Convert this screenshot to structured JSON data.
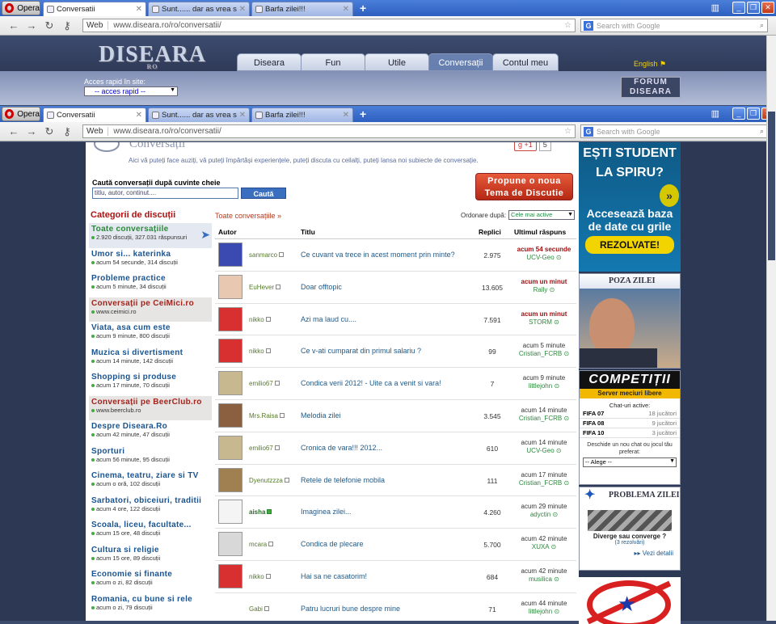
{
  "browser": {
    "opera_label": "Opera",
    "tabs": [
      {
        "label": "Conversatii",
        "active": true
      },
      {
        "label": "Sunt...... dar as vrea sa...",
        "active": false
      },
      {
        "label": "Barfa zilei!!!",
        "active": false
      }
    ],
    "web_label": "Web",
    "url": "www.diseara.ro/ro/conversatii/",
    "search_placeholder": "Search with Google"
  },
  "site": {
    "logo": "DISEARA",
    "logo_sub": "RO",
    "nav": [
      "Diseara",
      "Fun",
      "Utile",
      "Conversații",
      "Contul meu"
    ],
    "nav_active": "Conversații",
    "language": "English",
    "quick_label": "Acces rapid în site:",
    "quick_select": "-- acces rapid --",
    "forum_badge": "FORUM DISEARA"
  },
  "page": {
    "title": "Conversații",
    "intro": "Aici vă puteți face auziți, vă puteți împărtăși experiențele, puteți discuta cu ceilalți, puteți lansa noi subiecte de conversație.",
    "gplus_label": "+1",
    "gplus_count": "5",
    "search_label": "Caută conversații după cuvinte cheie",
    "search_placeholder": "titlu, autor, continut....",
    "search_button": "Caută",
    "propose_line1": "Propune o noua",
    "propose_line2": "Tema de Discutie",
    "categories_header": "Categorii de discuții",
    "all_label": "Toate conversațiile »",
    "order_label": "Ordonare după:",
    "order_value": "Cele mai active"
  },
  "categories": [
    {
      "name": "Toate conversațiile",
      "meta": "2.920 discuții, 327.031 răspunsuri",
      "type": "selected"
    },
    {
      "name": "Umor si... katerinka",
      "meta": "acum 54 secunde, 314 discuții",
      "type": "normal"
    },
    {
      "name": "Probleme practice",
      "meta": "acum 5 minute, 34 discuții",
      "type": "normal"
    },
    {
      "name": "Conversații pe CeiMici.ro",
      "meta": "www.ceimici.ro",
      "type": "external"
    },
    {
      "name": "Viata, asa cum este",
      "meta": "acum 9 minute, 800 discuții",
      "type": "normal"
    },
    {
      "name": "Muzica si divertisment",
      "meta": "acum 14 minute, 142 discuții",
      "type": "normal"
    },
    {
      "name": "Shopping si produse",
      "meta": "acum 17 minute, 70 discuții",
      "type": "normal"
    },
    {
      "name": "Conversații pe BeerClub.ro",
      "meta": "www.beerclub.ro",
      "type": "external"
    },
    {
      "name": "Despre Diseara.Ro",
      "meta": "acum 42 minute, 47 discuții",
      "type": "normal"
    },
    {
      "name": "Sporturi",
      "meta": "acum 56 minute, 95 discuții",
      "type": "normal"
    },
    {
      "name": "Cinema, teatru, ziare si TV",
      "meta": "acum o oră, 102 discuții",
      "type": "normal"
    },
    {
      "name": "Sarbatori, obiceiuri, traditii",
      "meta": "acum 4 ore, 122 discuții",
      "type": "normal"
    },
    {
      "name": "Scoala, liceu, facultate...",
      "meta": "acum 15 ore, 48 discuții",
      "type": "normal"
    },
    {
      "name": "Cultura si religie",
      "meta": "acum 15 ore, 89 discuții",
      "type": "normal"
    },
    {
      "name": "Economie si finante",
      "meta": "acum o zi, 82 discuții",
      "type": "normal"
    },
    {
      "name": "Romania, cu bune si rele",
      "meta": "acum o zi, 79 discuții",
      "type": "normal"
    }
  ],
  "table": {
    "headers": {
      "author": "Autor",
      "title": "Titlu",
      "replies": "Replici",
      "last": "Ultimul răspuns"
    },
    "rows": [
      {
        "user": "sanmarco",
        "title": "Ce cuvant va trece in acest moment prin minte?",
        "replies": "2.975",
        "time": "acum 54 secunde",
        "who": "UCV-Geo",
        "hot": true,
        "online": false,
        "avatar": "#3a4ab0"
      },
      {
        "user": "EuHever",
        "title": "Doar offtopic",
        "replies": "13.605",
        "time": "acum un minut",
        "who": "Rally",
        "hot": true,
        "online": false,
        "avatar": "#e8c8b0"
      },
      {
        "user": "nikko",
        "title": "Azi ma laud cu....",
        "replies": "7.591",
        "time": "acum un minut",
        "who": "STORM",
        "hot": true,
        "online": false,
        "avatar": "#d83030"
      },
      {
        "user": "nikko",
        "title": "Ce v-ati cumparat din primul salariu ?",
        "replies": "99",
        "time": "acum 5 minute",
        "who": "Cristian_FCRB",
        "hot": false,
        "online": false,
        "avatar": "#d83030"
      },
      {
        "user": "emilio67",
        "title": "Condica verii 2012! - Uite ca a venit si vara!",
        "replies": "7",
        "time": "acum 9 minute",
        "who": "littlejohn",
        "hot": false,
        "online": false,
        "avatar": "#c8b890"
      },
      {
        "user": "Mrs.Raisa",
        "title": "Melodia zilei",
        "replies": "3.545",
        "time": "acum 14 minute",
        "who": "Cristian_FCRB",
        "hot": false,
        "online": false,
        "avatar": "#8a6040"
      },
      {
        "user": "emilio67",
        "title": "Cronica de vara!!! 2012...",
        "replies": "610",
        "time": "acum 14 minute",
        "who": "UCV-Geo",
        "hot": false,
        "online": false,
        "avatar": "#c8b890"
      },
      {
        "user": "Dyenutzzza",
        "title": "Retele de telefonie mobila",
        "replies": "111",
        "time": "acum 17 minute",
        "who": "Cristian_FCRB",
        "hot": false,
        "online": false,
        "avatar": "#a08050"
      },
      {
        "user": "aisha",
        "title": "Imaginea zilei...",
        "replies": "4.260",
        "time": "acum 29 minute",
        "who": "adyctin",
        "hot": false,
        "online": true,
        "avatar": "#f4f4f4"
      },
      {
        "user": "mcara",
        "title": "Condica de plecare",
        "replies": "5.700",
        "time": "acum 42 minute",
        "who": "XUXA",
        "hot": false,
        "online": false,
        "avatar": "#d8d8d8"
      },
      {
        "user": "nikko",
        "title": "Hai sa ne casatorim!",
        "replies": "684",
        "time": "acum 42 minute",
        "who": "musilica",
        "hot": false,
        "online": false,
        "avatar": "#d83030"
      },
      {
        "user": "Gabi",
        "title": "Patru lucruri bune despre mine",
        "replies": "71",
        "time": "acum 44 minute",
        "who": "littlejohn",
        "hot": false,
        "online": false,
        "avatar": "#ffffff"
      }
    ]
  },
  "ads": {
    "student_line1": "EȘTI STUDENT",
    "student_line2": "LA SPIRU?",
    "student_line3": "Accesează baza de date cu grile",
    "student_button": "REZOLVATE!",
    "photo_header": "POZA ZILEI",
    "comp_title": "COMPETIȚII",
    "comp_sub": "Server meciuri libere",
    "chat_header": "Chat-uri active:",
    "chats": [
      {
        "game": "FIFA 07",
        "players": "18 jucători"
      },
      {
        "game": "FIFA 08",
        "players": "9 jucători"
      },
      {
        "game": "FIFA 10",
        "players": "3 jucători"
      }
    ],
    "open_chat": "Deschide un nou chat ou jocul tău preferat:",
    "choose": "-- Alege --",
    "problem_header": "PROBLEMA ZILEI",
    "problem_q": "Diverge sau converge ?",
    "problem_resolved": "(3 rezolvări)",
    "problem_link": "Vezi detalii"
  }
}
